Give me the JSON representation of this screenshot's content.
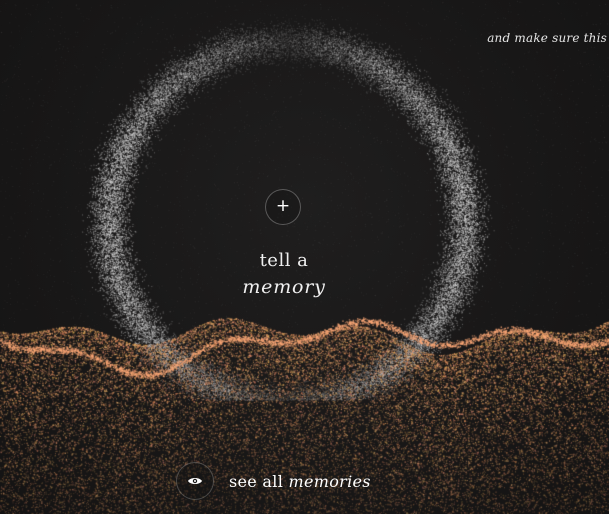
{
  "tagline": "and make sure this",
  "add_button": {
    "icon": "plus-icon",
    "symbol": "+"
  },
  "prompt": {
    "line1": "tell a",
    "line2": "memory"
  },
  "see_all": {
    "icon": "eye-icon",
    "prefix": "see all",
    "emphasis": "memories"
  },
  "colors": {
    "background": "#1a1919",
    "ring_particles": "#d8d8d8",
    "terrain_particles": "#e08a55",
    "text": "#f0f0f0"
  }
}
